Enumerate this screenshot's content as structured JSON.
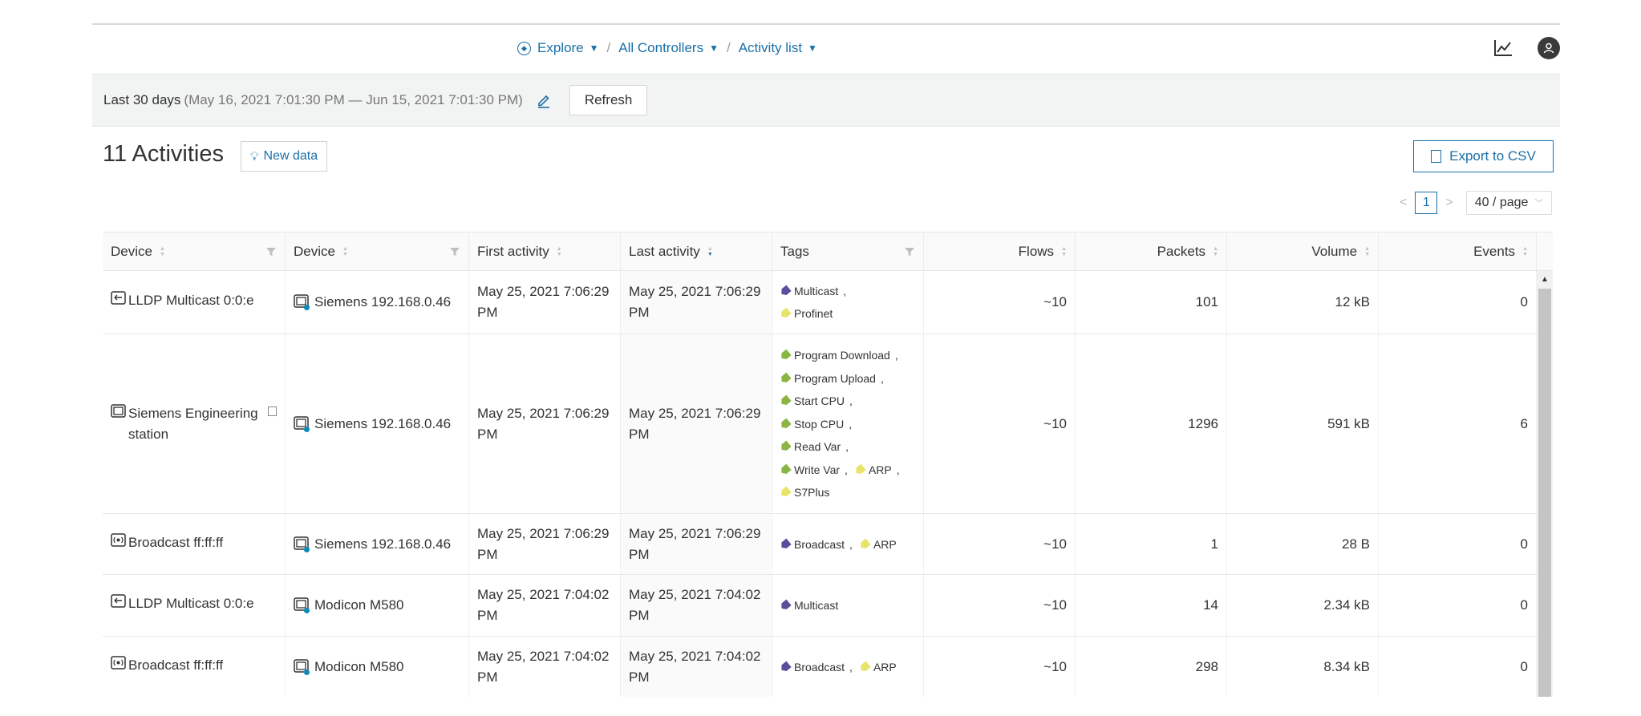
{
  "nav": {
    "explore": "Explore",
    "controllers": "All Controllers",
    "activity_list": "Activity list",
    "separator": "/"
  },
  "datebar": {
    "range_label": "Last 30 days",
    "range_detail": "(May 16, 2021 7:01:30 PM — Jun 15, 2021 7:01:30 PM)",
    "refresh": "Refresh"
  },
  "title": "11 Activities",
  "new_data": "New data",
  "export": "Export to CSV",
  "pager": {
    "prev": "<",
    "page": "1",
    "next": ">",
    "per_page": "40 / page"
  },
  "columns": {
    "device_a": "Device",
    "device_b": "Device",
    "first": "First activity",
    "last": "Last activity",
    "tags": "Tags",
    "flows": "Flows",
    "packets": "Packets",
    "volume": "Volume",
    "events": "Events"
  },
  "tag_colors": {
    "purple": "#5b4f9c",
    "yellow": "#e8e36a",
    "green": "#8bb542"
  },
  "rows": [
    {
      "device_a": "LLDP Multicast 0:0:e",
      "device_b": "Siemens 192.168.0.46",
      "first": "May 25, 2021 7:06:29 PM",
      "last": "May 25, 2021 7:06:29 PM",
      "tags": [
        [
          "Multicast",
          "purple",
          true
        ],
        [
          "Profinet",
          "yellow",
          false
        ]
      ],
      "flows": "~10",
      "packets": "101",
      "volume": "12 kB",
      "events": "0"
    },
    {
      "device_a": "Siemens Engineering station",
      "device_b": "Siemens 192.168.0.46",
      "first": "May 25, 2021 7:06:29 PM",
      "last": "May 25, 2021 7:06:29 PM",
      "tags": [
        [
          "Program Download",
          "green",
          true
        ],
        [
          "Program Upload",
          "green",
          true
        ],
        [
          "Start CPU",
          "green",
          true
        ],
        [
          "Stop CPU",
          "green",
          true
        ],
        [
          "Read Var",
          "green",
          true
        ],
        [
          "Write Var",
          "green",
          true,
          "ARP",
          "yellow",
          true
        ],
        [
          "S7Plus",
          "yellow",
          false
        ]
      ],
      "flows": "~10",
      "packets": "1296",
      "volume": "591 kB",
      "events": "6"
    },
    {
      "device_a": "Broadcast ff:ff:ff",
      "device_b": "Siemens 192.168.0.46",
      "first": "May 25, 2021 7:06:29 PM",
      "last": "May 25, 2021 7:06:29 PM",
      "tags": [
        [
          "Broadcast",
          "purple",
          true,
          "ARP",
          "yellow",
          false
        ]
      ],
      "flows": "~10",
      "packets": "1",
      "volume": "28 B",
      "events": "0"
    },
    {
      "device_a": "LLDP Multicast 0:0:e",
      "device_b": "Modicon M580",
      "first": "May 25, 2021 7:04:02 PM",
      "last": "May 25, 2021 7:04:02 PM",
      "tags": [
        [
          "Multicast",
          "purple",
          false
        ]
      ],
      "flows": "~10",
      "packets": "14",
      "volume": "2.34 kB",
      "events": "0"
    },
    {
      "device_a": "Broadcast ff:ff:ff",
      "device_b": "Modicon M580",
      "first": "May 25, 2021 7:04:02 PM",
      "last": "May 25, 2021 7:04:02 PM",
      "tags": [
        [
          "Broadcast",
          "purple",
          true,
          "ARP",
          "yellow",
          false
        ]
      ],
      "flows": "~10",
      "packets": "298",
      "volume": "8.34 kB",
      "events": "0"
    }
  ]
}
